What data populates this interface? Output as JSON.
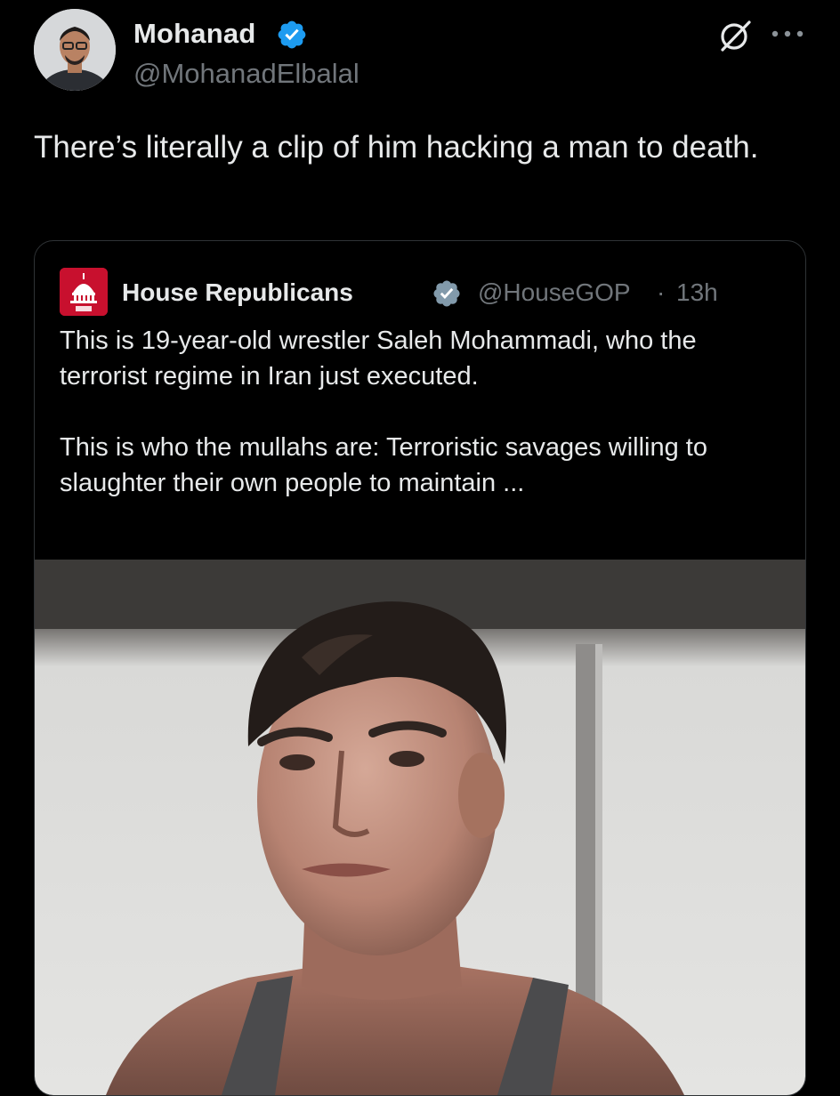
{
  "post": {
    "author_name": "Mohanad",
    "author_handle": "@MohanadElbalal",
    "text": "There’s literally a clip of him hacking a man to death.",
    "icons": {
      "avatar": "avatar-photo",
      "verified": "verified-badge-icon",
      "grok": "grok-icon",
      "more": "more-options-icon"
    }
  },
  "quote": {
    "author_name": "House Republicans",
    "author_handle": "@HouseGOP",
    "separator": "·",
    "time": "13h",
    "paragraphs": [
      "This is 19-year-old wrestler Saleh Mohammadi, who the terrorist regime in Iran just executed.",
      "This is who the mullahs are: Terroristic savages willing to slaughter their own people to maintain ..."
    ],
    "icons": {
      "avatar": "capitol-dome-logo",
      "verified": "verified-badge-icon",
      "media": "photo-of-wrestler"
    }
  },
  "colors": {
    "background": "#000000",
    "text_primary": "#e7e9ea",
    "text_secondary": "#71767b",
    "verified_blue": "#1d9bf0",
    "card_border": "#2f3336",
    "gop_red": "#c8102e"
  }
}
